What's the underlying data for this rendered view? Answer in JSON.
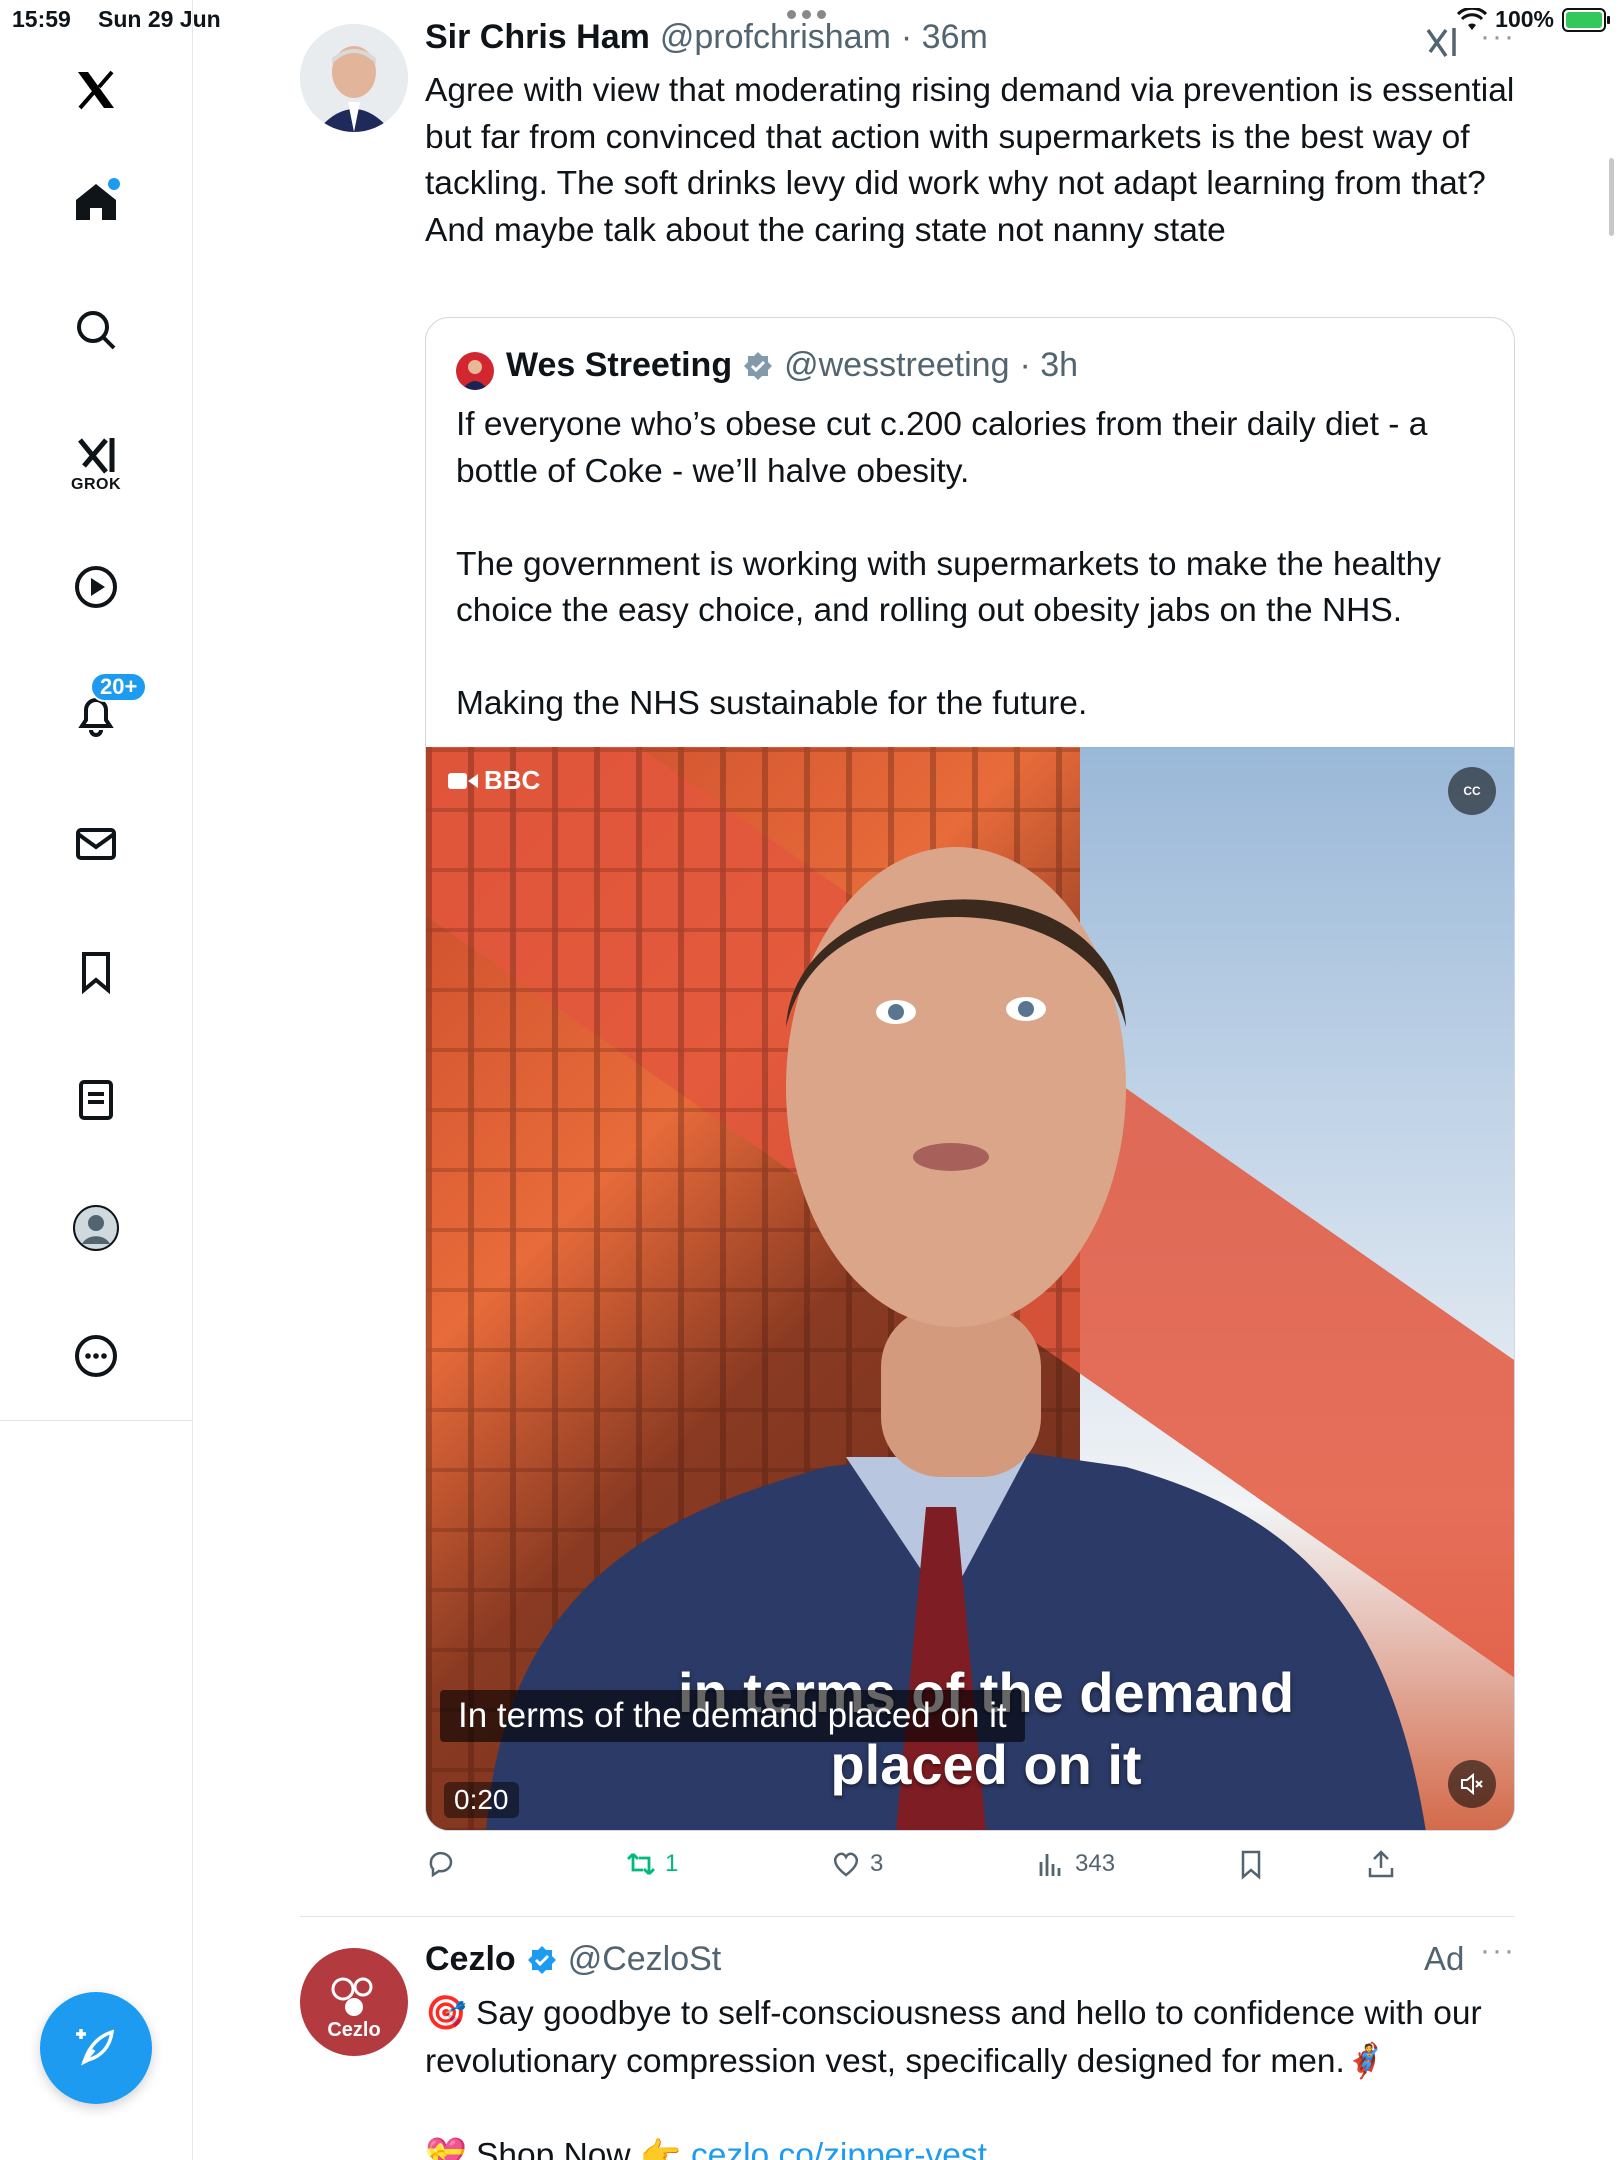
{
  "status_bar": {
    "time": "15:59",
    "date": "Sun 29 Jun",
    "battery": "100%",
    "battery_level": 1.0
  },
  "sidebar": {
    "items": [
      {
        "name": "home",
        "icon": "home-icon",
        "active": true
      },
      {
        "name": "explore",
        "icon": "search-icon"
      },
      {
        "name": "grok",
        "icon": "grok-icon",
        "label": "GROK"
      },
      {
        "name": "video",
        "icon": "play-icon"
      },
      {
        "name": "notifications",
        "icon": "bell-icon",
        "badge": "20+"
      },
      {
        "name": "messages",
        "icon": "envelope-icon"
      },
      {
        "name": "bookmarks",
        "icon": "bookmark-icon"
      },
      {
        "name": "lists",
        "icon": "list-icon"
      },
      {
        "name": "profile",
        "icon": "avatar-icon"
      },
      {
        "name": "more",
        "icon": "more-circle-icon"
      }
    ],
    "compose_icon": "compose-feather-icon"
  },
  "tweet": {
    "name": "Sir Chris Ham",
    "handle": "@profchrisham",
    "time": "· 36m",
    "text": "Agree with view that moderating rising demand via prevention is essential but far from convinced that action with supermarkets is the best way of tackling. The soft drinks levy did work why not adapt learning from that? And maybe talk about the caring state not nanny state",
    "quote": {
      "name": "Wes Streeting",
      "handle": "@wesstreeting",
      "time": "· 3h",
      "paragraphs": [
        "If everyone who’s obese cut c.200 calories from their daily diet - a bottle of Coke - we’ll halve obesity.",
        "The government is working with supermarkets to make the healthy choice the easy choice, and rolling out obesity jabs on the NHS.",
        "Making the NHS sustainable for the future."
      ],
      "video": {
        "brand": "BBC",
        "cc_label": "CC",
        "burned_caption_line1": "in terms of the demand",
        "burned_caption_line2": "placed on it",
        "cc_caption": "In terms of the demand placed on it",
        "elapsed": "0:20"
      }
    },
    "actions": {
      "reply": "",
      "retweets": "1",
      "likes": "3",
      "views": "343"
    }
  },
  "ad": {
    "name": "Cezlo",
    "handle": "@CezloSt",
    "label": "Ad",
    "avatar_text": "Cezlo",
    "line1_emoji": "🎯",
    "line1": "Say goodbye to self-consciousness and hello to confidence with our revolutionary compression vest, specifically designed for men.",
    "line1_end_emoji": "🦸",
    "line2_emoji": "💝",
    "line2": "Shop Now",
    "line2_pointer": "👉",
    "link": "cezlo.co/zipper-vest"
  },
  "colors": {
    "accent": "#1d9bf0",
    "retweet": "#00ba7c",
    "muted": "#536471"
  }
}
